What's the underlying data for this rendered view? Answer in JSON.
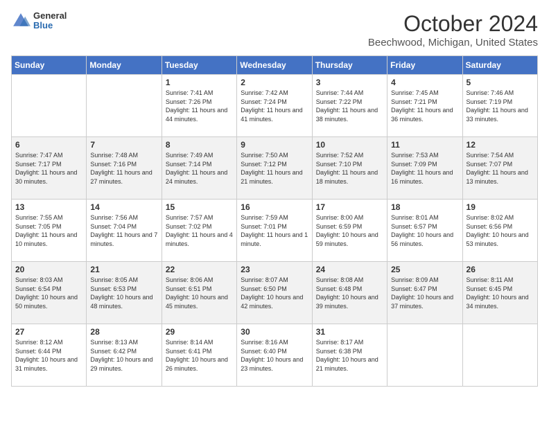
{
  "header": {
    "logo_general": "General",
    "logo_blue": "Blue",
    "month_title": "October 2024",
    "location": "Beechwood, Michigan, United States"
  },
  "days_of_week": [
    "Sunday",
    "Monday",
    "Tuesday",
    "Wednesday",
    "Thursday",
    "Friday",
    "Saturday"
  ],
  "weeks": [
    [
      {
        "num": "",
        "sunrise": "",
        "sunset": "",
        "daylight": ""
      },
      {
        "num": "",
        "sunrise": "",
        "sunset": "",
        "daylight": ""
      },
      {
        "num": "1",
        "sunrise": "Sunrise: 7:41 AM",
        "sunset": "Sunset: 7:26 PM",
        "daylight": "Daylight: 11 hours and 44 minutes."
      },
      {
        "num": "2",
        "sunrise": "Sunrise: 7:42 AM",
        "sunset": "Sunset: 7:24 PM",
        "daylight": "Daylight: 11 hours and 41 minutes."
      },
      {
        "num": "3",
        "sunrise": "Sunrise: 7:44 AM",
        "sunset": "Sunset: 7:22 PM",
        "daylight": "Daylight: 11 hours and 38 minutes."
      },
      {
        "num": "4",
        "sunrise": "Sunrise: 7:45 AM",
        "sunset": "Sunset: 7:21 PM",
        "daylight": "Daylight: 11 hours and 36 minutes."
      },
      {
        "num": "5",
        "sunrise": "Sunrise: 7:46 AM",
        "sunset": "Sunset: 7:19 PM",
        "daylight": "Daylight: 11 hours and 33 minutes."
      }
    ],
    [
      {
        "num": "6",
        "sunrise": "Sunrise: 7:47 AM",
        "sunset": "Sunset: 7:17 PM",
        "daylight": "Daylight: 11 hours and 30 minutes."
      },
      {
        "num": "7",
        "sunrise": "Sunrise: 7:48 AM",
        "sunset": "Sunset: 7:16 PM",
        "daylight": "Daylight: 11 hours and 27 minutes."
      },
      {
        "num": "8",
        "sunrise": "Sunrise: 7:49 AM",
        "sunset": "Sunset: 7:14 PM",
        "daylight": "Daylight: 11 hours and 24 minutes."
      },
      {
        "num": "9",
        "sunrise": "Sunrise: 7:50 AM",
        "sunset": "Sunset: 7:12 PM",
        "daylight": "Daylight: 11 hours and 21 minutes."
      },
      {
        "num": "10",
        "sunrise": "Sunrise: 7:52 AM",
        "sunset": "Sunset: 7:10 PM",
        "daylight": "Daylight: 11 hours and 18 minutes."
      },
      {
        "num": "11",
        "sunrise": "Sunrise: 7:53 AM",
        "sunset": "Sunset: 7:09 PM",
        "daylight": "Daylight: 11 hours and 16 minutes."
      },
      {
        "num": "12",
        "sunrise": "Sunrise: 7:54 AM",
        "sunset": "Sunset: 7:07 PM",
        "daylight": "Daylight: 11 hours and 13 minutes."
      }
    ],
    [
      {
        "num": "13",
        "sunrise": "Sunrise: 7:55 AM",
        "sunset": "Sunset: 7:05 PM",
        "daylight": "Daylight: 11 hours and 10 minutes."
      },
      {
        "num": "14",
        "sunrise": "Sunrise: 7:56 AM",
        "sunset": "Sunset: 7:04 PM",
        "daylight": "Daylight: 11 hours and 7 minutes."
      },
      {
        "num": "15",
        "sunrise": "Sunrise: 7:57 AM",
        "sunset": "Sunset: 7:02 PM",
        "daylight": "Daylight: 11 hours and 4 minutes."
      },
      {
        "num": "16",
        "sunrise": "Sunrise: 7:59 AM",
        "sunset": "Sunset: 7:01 PM",
        "daylight": "Daylight: 11 hours and 1 minute."
      },
      {
        "num": "17",
        "sunrise": "Sunrise: 8:00 AM",
        "sunset": "Sunset: 6:59 PM",
        "daylight": "Daylight: 10 hours and 59 minutes."
      },
      {
        "num": "18",
        "sunrise": "Sunrise: 8:01 AM",
        "sunset": "Sunset: 6:57 PM",
        "daylight": "Daylight: 10 hours and 56 minutes."
      },
      {
        "num": "19",
        "sunrise": "Sunrise: 8:02 AM",
        "sunset": "Sunset: 6:56 PM",
        "daylight": "Daylight: 10 hours and 53 minutes."
      }
    ],
    [
      {
        "num": "20",
        "sunrise": "Sunrise: 8:03 AM",
        "sunset": "Sunset: 6:54 PM",
        "daylight": "Daylight: 10 hours and 50 minutes."
      },
      {
        "num": "21",
        "sunrise": "Sunrise: 8:05 AM",
        "sunset": "Sunset: 6:53 PM",
        "daylight": "Daylight: 10 hours and 48 minutes."
      },
      {
        "num": "22",
        "sunrise": "Sunrise: 8:06 AM",
        "sunset": "Sunset: 6:51 PM",
        "daylight": "Daylight: 10 hours and 45 minutes."
      },
      {
        "num": "23",
        "sunrise": "Sunrise: 8:07 AM",
        "sunset": "Sunset: 6:50 PM",
        "daylight": "Daylight: 10 hours and 42 minutes."
      },
      {
        "num": "24",
        "sunrise": "Sunrise: 8:08 AM",
        "sunset": "Sunset: 6:48 PM",
        "daylight": "Daylight: 10 hours and 39 minutes."
      },
      {
        "num": "25",
        "sunrise": "Sunrise: 8:09 AM",
        "sunset": "Sunset: 6:47 PM",
        "daylight": "Daylight: 10 hours and 37 minutes."
      },
      {
        "num": "26",
        "sunrise": "Sunrise: 8:11 AM",
        "sunset": "Sunset: 6:45 PM",
        "daylight": "Daylight: 10 hours and 34 minutes."
      }
    ],
    [
      {
        "num": "27",
        "sunrise": "Sunrise: 8:12 AM",
        "sunset": "Sunset: 6:44 PM",
        "daylight": "Daylight: 10 hours and 31 minutes."
      },
      {
        "num": "28",
        "sunrise": "Sunrise: 8:13 AM",
        "sunset": "Sunset: 6:42 PM",
        "daylight": "Daylight: 10 hours and 29 minutes."
      },
      {
        "num": "29",
        "sunrise": "Sunrise: 8:14 AM",
        "sunset": "Sunset: 6:41 PM",
        "daylight": "Daylight: 10 hours and 26 minutes."
      },
      {
        "num": "30",
        "sunrise": "Sunrise: 8:16 AM",
        "sunset": "Sunset: 6:40 PM",
        "daylight": "Daylight: 10 hours and 23 minutes."
      },
      {
        "num": "31",
        "sunrise": "Sunrise: 8:17 AM",
        "sunset": "Sunset: 6:38 PM",
        "daylight": "Daylight: 10 hours and 21 minutes."
      },
      {
        "num": "",
        "sunrise": "",
        "sunset": "",
        "daylight": ""
      },
      {
        "num": "",
        "sunrise": "",
        "sunset": "",
        "daylight": ""
      }
    ]
  ]
}
